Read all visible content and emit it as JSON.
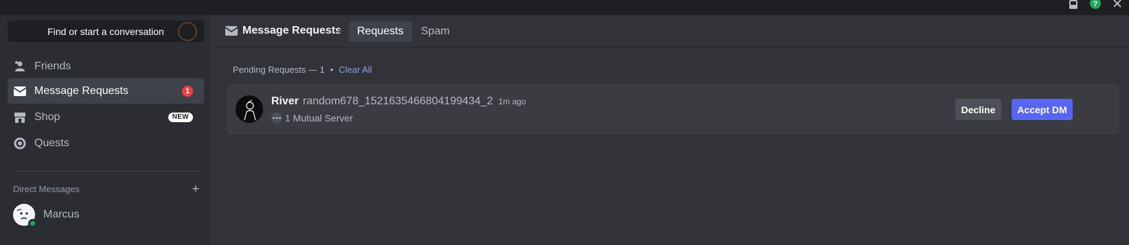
{
  "titlebar": {
    "icons": [
      "inbox-icon",
      "help-icon",
      "close-icon"
    ]
  },
  "sidebar": {
    "search_placeholder": "Find or start a conversation",
    "items": [
      {
        "label": "Friends",
        "icon": "friends-icon"
      },
      {
        "label": "Message Requests",
        "icon": "envelope-icon",
        "badge": "1",
        "active": true
      },
      {
        "label": "Shop",
        "icon": "shop-icon",
        "badge": "NEW"
      },
      {
        "label": "Quests",
        "icon": "quests-icon"
      }
    ],
    "dm_header": "Direct Messages",
    "dm_add": "+",
    "dms": [
      {
        "name": "Marcus",
        "status": "online"
      }
    ]
  },
  "main": {
    "title": "Message Requests",
    "tabs": [
      {
        "label": "Requests",
        "selected": true
      },
      {
        "label": "Spam",
        "selected": false
      }
    ],
    "pending_label": "Pending Requests — 1",
    "pending_sep": "•",
    "clear_all": "Clear All",
    "requests": [
      {
        "display_name": "River",
        "username": "random678_1521635466804199434_2",
        "time": "1m ago",
        "mutual": "1 Mutual Server",
        "decline_label": "Decline",
        "accept_label": "Accept DM"
      }
    ]
  },
  "colors": {
    "accent": "#5865f2",
    "badge_red": "#f23f43",
    "online_green": "#23a55a",
    "link": "#949cf7"
  }
}
